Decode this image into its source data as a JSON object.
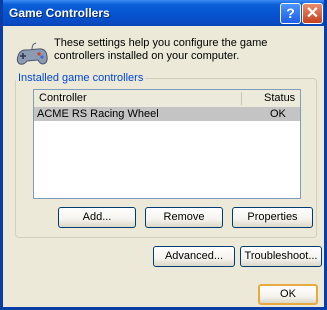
{
  "window": {
    "title": "Game Controllers",
    "help_label": "?",
    "close_label": "✕"
  },
  "info_text": "These settings help you configure the game controllers installed on your computer.",
  "group_label": "Installed game controllers",
  "table": {
    "headers": [
      "Controller",
      "Status"
    ],
    "rows": [
      {
        "controller": "ACME RS Racing Wheel",
        "status": "OK"
      }
    ]
  },
  "buttons": {
    "add": "Add...",
    "remove": "Remove",
    "properties": "Properties",
    "advanced": "Advanced...",
    "troubleshoot": "Troubleshoot...",
    "ok": "OK"
  },
  "icons": {
    "header_icon": "game-controller-icon"
  },
  "colors": {
    "titlebar": "#0553d0",
    "window_bg": "#ece9d8",
    "group_label": "#0046d5",
    "selected_row": "#c4c4c4"
  }
}
